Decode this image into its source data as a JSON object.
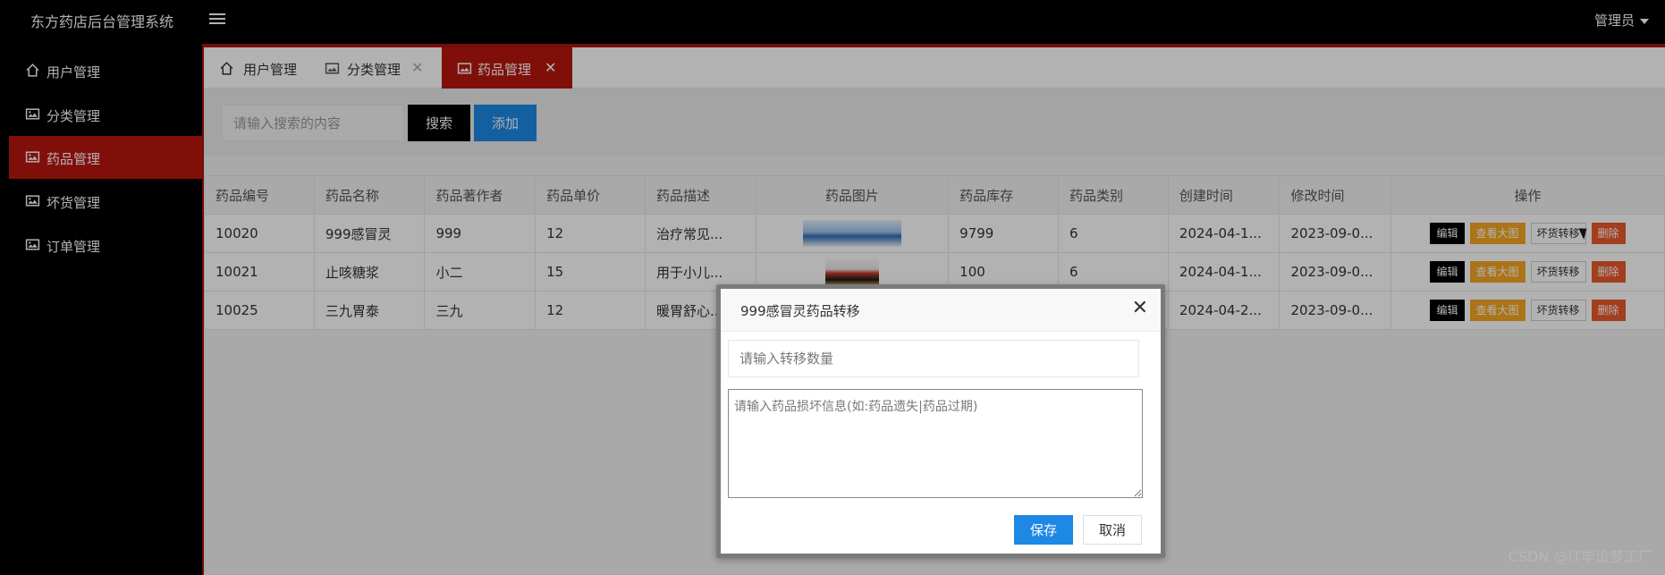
{
  "app": {
    "title": "东方药店后台管理系统",
    "user": "管理员"
  },
  "colors": {
    "accent": "#b8160f",
    "primary_button": "#1e88e5",
    "search_button": "#000000",
    "view_button": "#f5a623",
    "delete_button": "#ea5a2c"
  },
  "sidebar": {
    "items": [
      {
        "label": "用户管理",
        "icon": "home-icon"
      },
      {
        "label": "分类管理",
        "icon": "image-icon"
      },
      {
        "label": "药品管理",
        "icon": "image-icon",
        "active": true
      },
      {
        "label": "坏货管理",
        "icon": "image-icon"
      },
      {
        "label": "订单管理",
        "icon": "image-icon"
      }
    ]
  },
  "tabs": [
    {
      "label": "用户管理",
      "icon": "home-icon",
      "closable": false
    },
    {
      "label": "分类管理",
      "icon": "image-icon",
      "closable": true
    },
    {
      "label": "药品管理",
      "icon": "image-icon",
      "closable": true,
      "active": true
    }
  ],
  "toolbar": {
    "search_placeholder": "请输入搜索的内容",
    "search_label": "搜索",
    "add_label": "添加"
  },
  "table": {
    "columns": [
      "药品编号",
      "药品名称",
      "药品著作者",
      "药品单价",
      "药品描述",
      "药品图片",
      "药品库存",
      "药品类别",
      "创建时间",
      "修改时间",
      "操作"
    ],
    "actions": {
      "edit": "编辑",
      "view": "查看大图",
      "transfer": "坏货转移",
      "delete": "删除"
    },
    "rows": [
      {
        "id": "10020",
        "name": "999感冒灵",
        "author": "999",
        "price": "12",
        "desc": "治疗常见...",
        "stock": "9799",
        "category": "6",
        "created": "2024-04-1...",
        "modified": "2023-09-0..."
      },
      {
        "id": "10021",
        "name": "止咳糖浆",
        "author": "小二",
        "price": "15",
        "desc": "用于小儿...",
        "stock": "100",
        "category": "6",
        "created": "2024-04-1...",
        "modified": "2023-09-0..."
      },
      {
        "id": "10025",
        "name": "三九胃泰",
        "author": "三九",
        "price": "12",
        "desc": "暖胃舒心...",
        "stock": "",
        "category": "",
        "created": "2024-04-2...",
        "modified": "2023-09-0..."
      }
    ]
  },
  "modal": {
    "title": "999感冒灵药品转移",
    "qty_placeholder": "请输入转移数量",
    "info_placeholder": "请输入药品损坏信息(如:药品遗失|药品过期)",
    "save_label": "保存",
    "cancel_label": "取消"
  },
  "watermark": "CSDN @IT毕设梦工厂"
}
